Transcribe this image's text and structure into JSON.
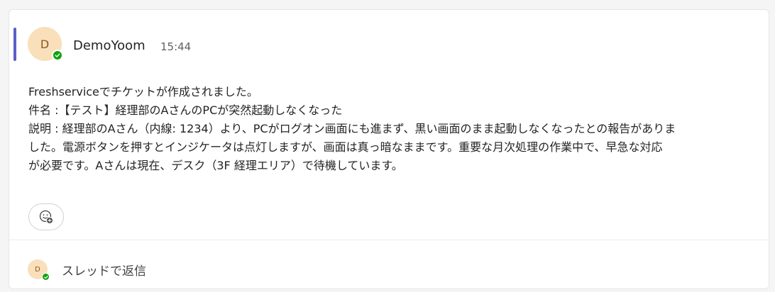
{
  "colors": {
    "accent": "#5b5fc7",
    "avatar_bg": "#f9dfba",
    "avatar_text": "#8a5a1e",
    "presence_available": "#13a10e"
  },
  "message": {
    "avatar_initial": "D",
    "sender": "DemoYoom",
    "timestamp": "15:44",
    "presence": "available",
    "lines": [
      "Freshserviceでチケットが作成されました。",
      "件名 :【テスト】経理部のAさんのPCが突然起動しなくなった",
      "説明 : 経理部のAさん（内線: 1234）より、PCがログオン画面にも進まず、黒い画面のまま起動しなくなったとの報告がありま",
      "した。電源ボタンを押すとインジケータは点灯しますが、画面は真っ暗なままです。重要な月次処理の作業中で、早急な対応",
      "が必要です。Aさんは現在、デスク（3F 経理エリア）で待機しています。"
    ]
  },
  "reaction": {
    "icon": "add-reaction-icon"
  },
  "reply": {
    "avatar_initial": "D",
    "label": "スレッドで返信"
  }
}
